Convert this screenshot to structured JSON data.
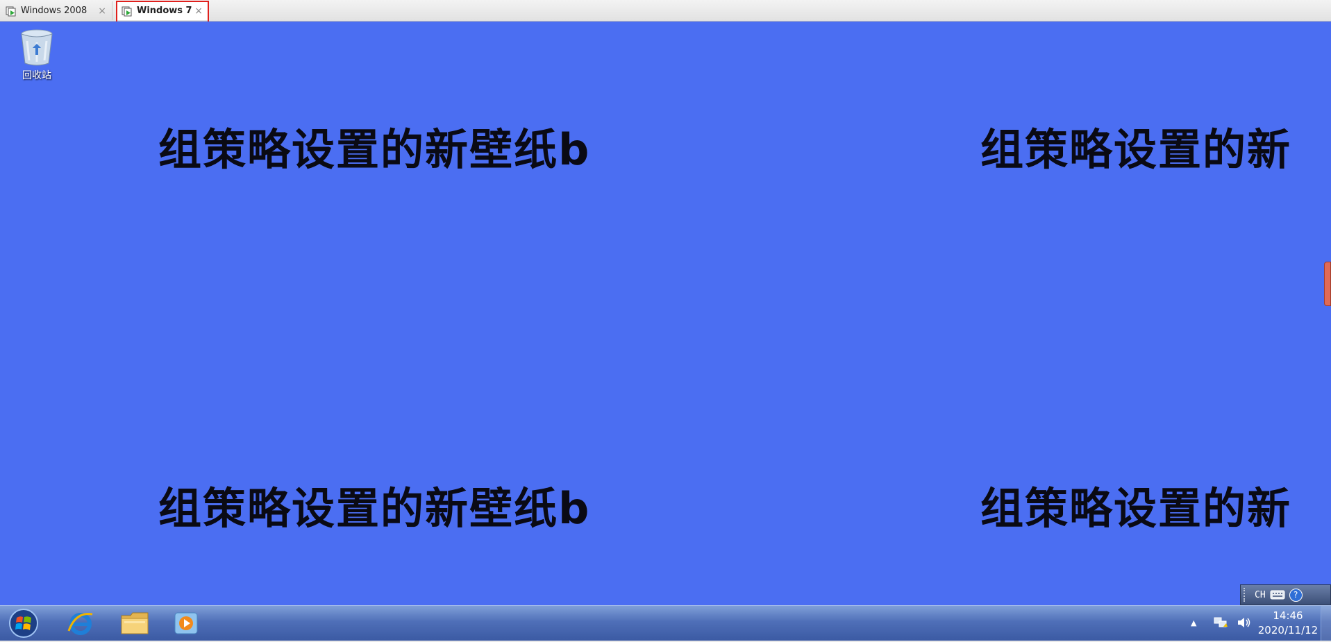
{
  "tabs": [
    {
      "label": "Windows 2008",
      "close": "×"
    },
    {
      "label": "Windows 7",
      "close": "×"
    }
  ],
  "desktop": {
    "background_color": "#4b6ef2",
    "wallpaper_text": "组策略设置的新壁纸b",
    "wallpaper_text_cropped": "组策略设置的新",
    "recycle_bin_label": "回收站"
  },
  "language_bar": {
    "language": "CH",
    "help": "?"
  },
  "taskbar": {
    "pinned": [
      "start-orb-icon",
      "internet-explorer-icon",
      "explorer-folder-icon",
      "media-player-icon"
    ],
    "time": "14:46",
    "date": "2020/11/12",
    "tray_arrow": "▲"
  },
  "colors": {
    "highlight": "#e0201c",
    "taskbar": "#4f6fb8"
  }
}
